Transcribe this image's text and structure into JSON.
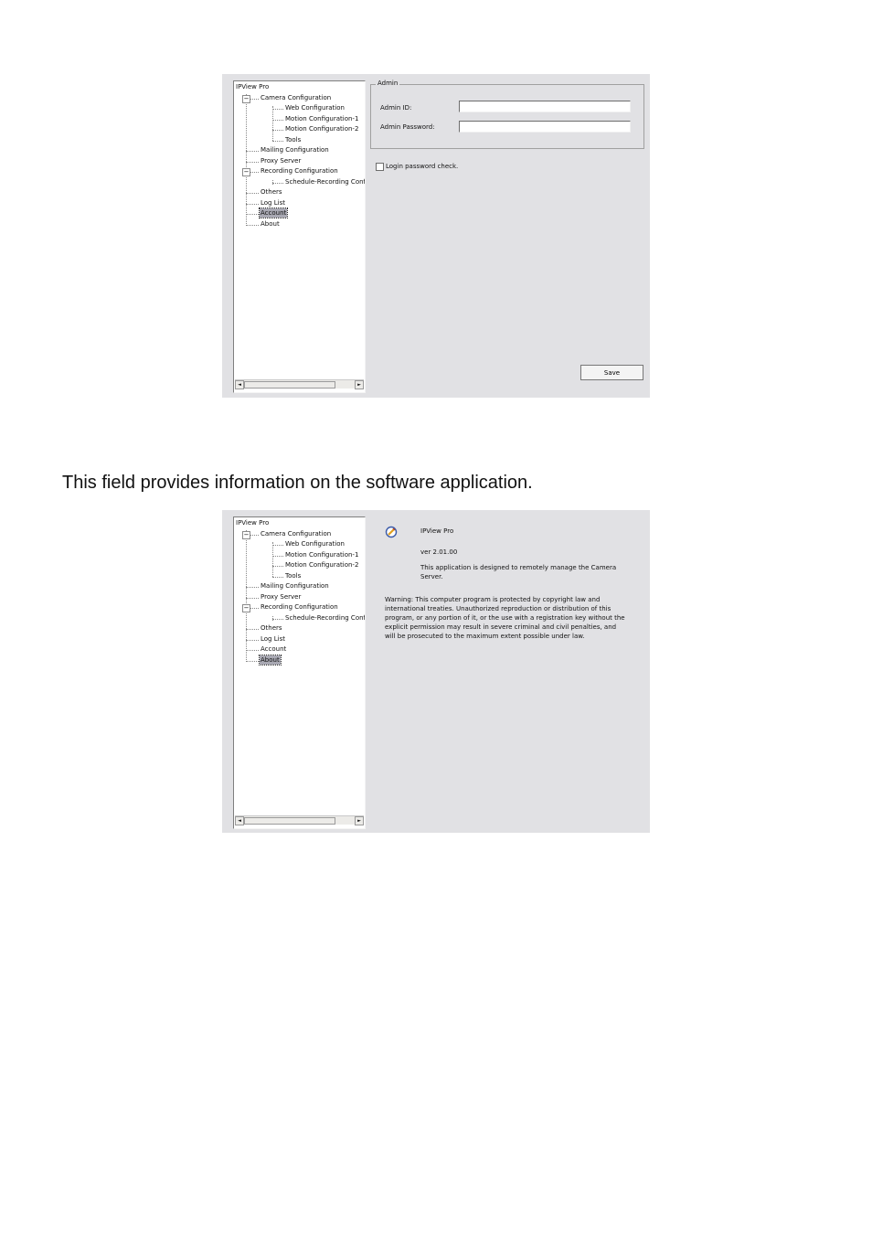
{
  "caption": "This field provides information on the software application.",
  "tree": {
    "root": "IPView Pro",
    "camera": "Camera Configuration",
    "web": "Web Configuration",
    "motion1": "Motion Configuration-1",
    "motion2": "Motion Configuration-2",
    "tools": "Tools",
    "mailing": "Mailing Configuration",
    "proxy": "Proxy Server",
    "recording": "Recording Configuration",
    "schedule": "Schedule-Recording Configuration",
    "others": "Others",
    "loglist": "Log List",
    "account": "Account",
    "about": "About",
    "expander_open": "−"
  },
  "account_panel": {
    "group_title": "Admin",
    "admin_id_label": "Admin ID:",
    "admin_id_value": "",
    "admin_password_label": "Admin Password:",
    "admin_password_value": "",
    "login_check_label": "Login password check.",
    "login_check_checked": false,
    "save_label": "Save",
    "selected_node": "Account"
  },
  "about_panel": {
    "app_name": "IPView Pro",
    "version": "ver 2.01.00",
    "description": "This application is designed to remotely manage the Camera Server.",
    "warning": "Warning: This computer program is protected by copyright law and international treaties. Unauthorized reproduction or distribution of this program, or any portion of it, or the use with a registration key without the explicit permission may result in severe criminal and civil penalties, and will be prosecuted to the maximum extent possible under law.",
    "selected_node": "About",
    "icon": "app-icon"
  },
  "scroll": {
    "left_arrow": "◄",
    "right_arrow": "►"
  },
  "colors": {
    "panel_bg": "#e1e1e4",
    "selection": "#a9a9b3"
  }
}
